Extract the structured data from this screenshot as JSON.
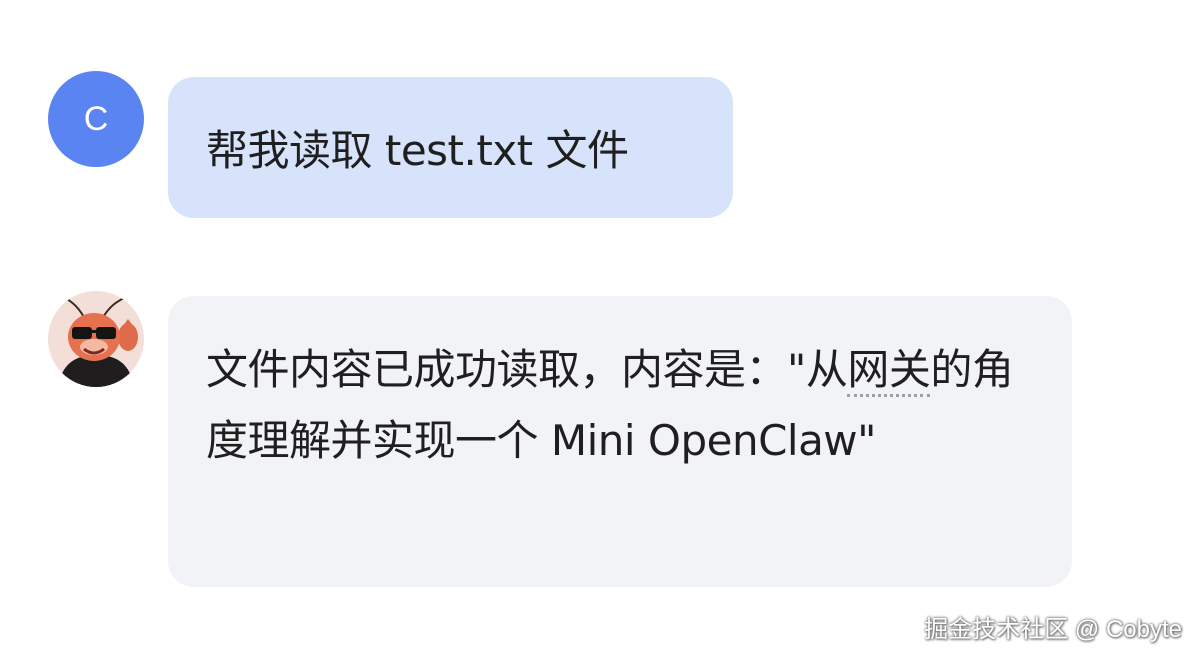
{
  "user_message": {
    "avatar_initial": "C",
    "text": "帮我读取 test.txt 文件"
  },
  "bot_message": {
    "avatar_icon": "lobster-mascot-avatar",
    "text_before": "文件内容已成功读取，内容是：\"从",
    "text_underlined": "网关",
    "text_after": "的角度理解并实现一个 Mini OpenClaw\""
  },
  "watermark": {
    "text": "掘金技术社区 @ Cobyte"
  },
  "colors": {
    "user_avatar_bg": "#5b84f3",
    "user_bubble_bg": "#d7e3fb",
    "bot_bubble_bg": "#f2f3f6",
    "text": "#1f1f1f"
  }
}
